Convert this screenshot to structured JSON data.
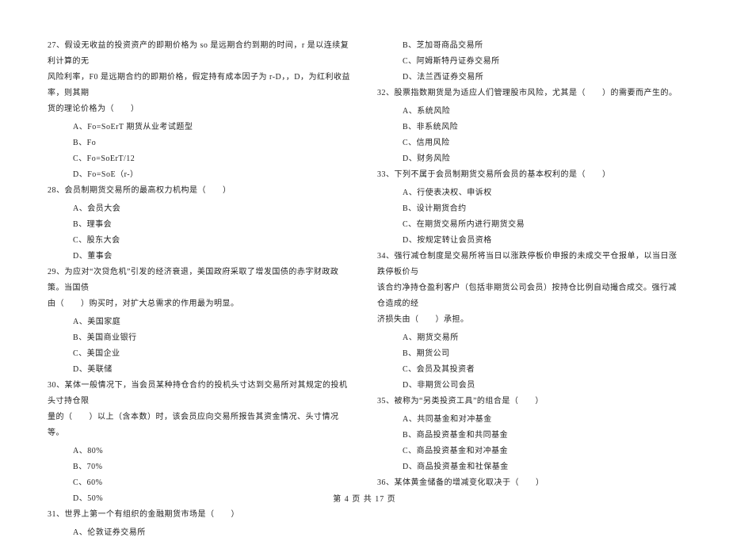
{
  "left": {
    "q27": {
      "line1": "27、假设无收益的投资资产的即期价格为 so 是远期合约到期的时间，r 是以连续复利计算的无",
      "line2": "风险利率，F0 是远期合约的即期价格，假定持有成本因子为 r-D，，D，为红利收益率，则其期",
      "line3": "货的理论价格为（　　）",
      "a": "A、Fo=SoErT 期货从业考试题型",
      "b": "B、Fo",
      "c": "C、Fo=SoErT/12",
      "d": "D、Fo=SoE（r-）"
    },
    "q28": {
      "t": "28、会员制期货交易所的最高权力机构是（　　）",
      "a": "A、会员大会",
      "b": "B、理事会",
      "c": "C、股东大会",
      "d": "D、董事会"
    },
    "q29": {
      "line1": "29、为应对“次贷危机”引发的经济衰退，美国政府采取了增发国债的赤字财政政策。当国债",
      "line2": "由（　　）购买时，对扩大总需求的作用最为明显。",
      "a": "A、美国家庭",
      "b": "B、美国商业银行",
      "c": "C、美国企业",
      "d": "D、美联储"
    },
    "q30": {
      "line1": "30、某体一般情况下，当会员某种持仓合约的投机头寸达到交易所对其规定的投机头寸持仓限",
      "line2": "量的（　　）以上（含本数）时，该会员应向交易所报告其资金情况、头寸情况等。",
      "a": "A、80%",
      "b": "B、70%",
      "c": "C、60%",
      "d": "D、50%"
    },
    "q31": {
      "t": "31、世界上第一个有组织的金融期货市场是（　　）",
      "a": "A、伦敦证券交易所"
    }
  },
  "right": {
    "q31": {
      "b": "B、芝加哥商品交易所",
      "c": "C、阿姆斯特丹证券交易所",
      "d": "D、法兰西证券交易所"
    },
    "q32": {
      "t": "32、股票指数期货是为适应人们管理股市风险，尤其是（　　）的需要而产生的。",
      "a": "A、系统风险",
      "b": "B、非系统风险",
      "c": "C、信用风险",
      "d": "D、财务风险"
    },
    "q33": {
      "t": "33、下列不属于会员制期货交易所会员的基本权利的是（　　）",
      "a": "A、行使表决权、申诉权",
      "b": "B、设计期货合约",
      "c": "C、在期货交易所内进行期货交易",
      "d": "D、按规定转让会员资格"
    },
    "q34": {
      "line1": "34、强行减仓制度是交易所将当日以涨跌停板价申报的未成交平仓报单，以当日涨跌停板价与",
      "line2": "该合约净持仓盈利客户（包括非期货公司会员）按持仓比例自动撮合成交。强行减仓造成的经",
      "line3": "济损失由（　　）承担。",
      "a": "A、期货交易所",
      "b": "B、期货公司",
      "c": "C、会员及其投资者",
      "d": "D、非期货公司会员"
    },
    "q35": {
      "t": "35、被称为“另类投资工具”的组合是（　　）",
      "a": "A、共同基金和对冲基金",
      "b": "B、商品投资基金和共同基金",
      "c": "C、商品投资基金和对冲基金",
      "d": "D、商品投资基金和社保基金"
    },
    "q36": {
      "t": "36、某体黄金储备的增减变化取决于（　　）"
    }
  },
  "footer": "第 4 页 共 17 页"
}
